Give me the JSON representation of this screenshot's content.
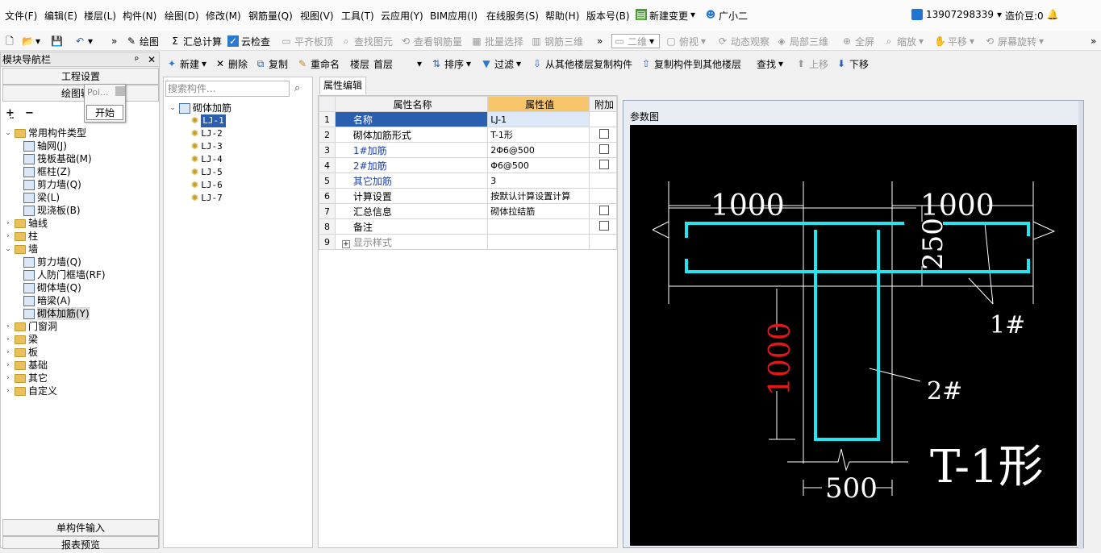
{
  "menu": [
    "文件(F)",
    "编辑(E)",
    "楼层(L)",
    "构件(N)",
    "绘图(D)",
    "修改(M)",
    "钢筋量(Q)",
    "视图(V)",
    "工具(T)",
    "云应用(Y)",
    "BIM应用(I)",
    "在线服务(S)",
    "帮助(H)",
    "版本号(B)"
  ],
  "menu_right": {
    "new_change": "新建变更",
    "assistant": "广小二",
    "phone": "13907298339",
    "beans": "造价豆:0"
  },
  "toolbar1": {
    "draw": "绘图",
    "sum": "汇总计算",
    "cloud_check": "云检查",
    "align": "平齐板顶",
    "find": "查找图元",
    "view_rebar": "查看钢筋量",
    "batch": "批量选择",
    "rebar3d": "钢筋三维",
    "view2d": "二维",
    "top_view": "俯视",
    "dynamic": "动态观察",
    "local3d": "局部三维",
    "fullscreen": "全屏",
    "zoom": "缩放",
    "pan": "平移",
    "rotate": "屏幕旋转"
  },
  "toolbar2": {
    "new": "新建",
    "delete": "删除",
    "copy": "复制",
    "rename": "重命名",
    "floor_label": "楼层",
    "floor_value": "首层",
    "sort": "排序",
    "filter": "过滤",
    "copy_from": "从其他楼层复制构件",
    "copy_to": "复制构件到其他楼层",
    "find": "查找",
    "up": "上移",
    "down": "下移"
  },
  "nav": {
    "title": "模块导航栏",
    "project_settings": "工程设置",
    "drawing_input": "绘图输入",
    "single_input": "单构件输入",
    "report": "报表预览"
  },
  "popup": {
    "text": "Poi...",
    "start": "开始"
  },
  "tree": [
    {
      "label": "常用构件类型",
      "level": 0,
      "open": true
    },
    {
      "label": "轴网(J)",
      "level": 1
    },
    {
      "label": "筏板基础(M)",
      "level": 1
    },
    {
      "label": "框柱(Z)",
      "level": 1
    },
    {
      "label": "剪力墙(Q)",
      "level": 1
    },
    {
      "label": "梁(L)",
      "level": 1
    },
    {
      "label": "现浇板(B)",
      "level": 1
    },
    {
      "label": "轴线",
      "level": 0
    },
    {
      "label": "柱",
      "level": 0
    },
    {
      "label": "墙",
      "level": 0,
      "open": true
    },
    {
      "label": "剪力墙(Q)",
      "level": 1
    },
    {
      "label": "人防门框墙(RF)",
      "level": 1
    },
    {
      "label": "砌体墙(Q)",
      "level": 1
    },
    {
      "label": "暗梁(A)",
      "level": 1
    },
    {
      "label": "砌体加筋(Y)",
      "level": 1,
      "selected": true
    },
    {
      "label": "门窗洞",
      "level": 0
    },
    {
      "label": "梁",
      "level": 0
    },
    {
      "label": "板",
      "level": 0
    },
    {
      "label": "基础",
      "level": 0
    },
    {
      "label": "其它",
      "level": 0
    },
    {
      "label": "自定义",
      "level": 0
    }
  ],
  "search_placeholder": "搜索构件...",
  "components": {
    "root": "砌体加筋",
    "items": [
      "LJ-1",
      "LJ-2",
      "LJ-3",
      "LJ-4",
      "LJ-5",
      "LJ-6",
      "LJ-7"
    ]
  },
  "prop_tab": "属性编辑",
  "prop_headers": [
    "属性名称",
    "属性值",
    "附加"
  ],
  "props": [
    {
      "n": "1",
      "name": "名称",
      "value": "LJ-1",
      "cb": false,
      "blue": true
    },
    {
      "n": "2",
      "name": "砌体加筋形式",
      "value": "T-1形",
      "cb": true,
      "blue": false
    },
    {
      "n": "3",
      "name": "1#加筋",
      "value": "2Φ6@500",
      "cb": true,
      "blue": true
    },
    {
      "n": "4",
      "name": "2#加筋",
      "value": "Φ6@500",
      "cb": true,
      "blue": true
    },
    {
      "n": "5",
      "name": "其它加筋",
      "value": "3",
      "cb": false,
      "blue": true
    },
    {
      "n": "6",
      "name": "计算设置",
      "value": "按默认计算设置计算",
      "cb": false,
      "blue": false
    },
    {
      "n": "7",
      "name": "汇总信息",
      "value": "砌体拉结筋",
      "cb": true,
      "blue": false
    },
    {
      "n": "8",
      "name": "备注",
      "value": "",
      "cb": true,
      "blue": false
    },
    {
      "n": "9",
      "name": "显示样式",
      "value": "",
      "cb": false,
      "blue": false
    }
  ],
  "ref": {
    "title": "参数图",
    "dim_left": "1000",
    "dim_right": "1000",
    "dim_250": "250",
    "dim_1000v": "1000",
    "dim_500": "500",
    "label_1": "1#",
    "label_2": "2#",
    "shape": "T-1形"
  }
}
